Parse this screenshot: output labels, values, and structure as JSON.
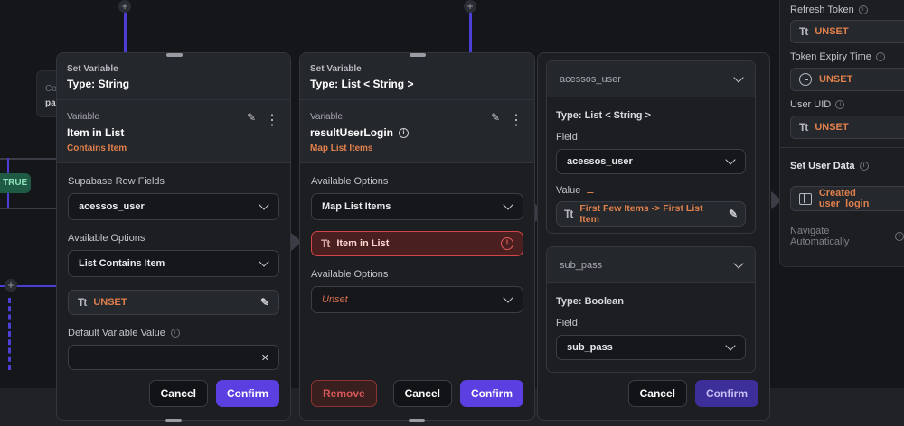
{
  "canvas": {
    "true_pill": "TRUE",
    "ghost_card_line1": "Co",
    "ghost_card_line2": "pa"
  },
  "panel1": {
    "header_small": "Set Variable",
    "header_type": "Type: String",
    "variable_label": "Variable",
    "variable_name": "Item in List",
    "variable_subtitle": "Contains Item",
    "supabase_label": "Supabase Row Fields",
    "supabase_value": "acessos_user",
    "options_label": "Available Options",
    "options_value": "List Contains Item",
    "unset_value": "UNSET",
    "default_label": "Default Variable Value",
    "default_value": "",
    "cancel": "Cancel",
    "confirm": "Confirm"
  },
  "panel2": {
    "header_small": "Set Variable",
    "header_type": "Type: List < String >",
    "variable_label": "Variable",
    "variable_name": "resultUserLogin",
    "variable_subtitle": "Map List Items",
    "options_label": "Available Options",
    "options_value": "Map List Items",
    "error_item": "Item in List",
    "options2_label": "Available Options",
    "options2_value": "Unset",
    "remove": "Remove",
    "cancel": "Cancel",
    "confirm": "Confirm"
  },
  "panel3": {
    "card1_title": "acessos_user",
    "card1_type": "Type: List < String >",
    "card1_field_label": "Field",
    "card1_field_value": "acessos_user",
    "card1_value_label": "Value",
    "card1_value": "First Few Items -> First List Item",
    "card2_title": "sub_pass",
    "card2_type": "Type: Boolean",
    "card2_field_label": "Field",
    "card2_field_value": "sub_pass",
    "cancel": "Cancel",
    "confirm": "Confirm"
  },
  "right_panel": {
    "refresh_label": "Refresh Token",
    "refresh_value": "UNSET",
    "expiry_label": "Token Expiry Time",
    "expiry_value": "UNSET",
    "uid_label": "User UID",
    "uid_value": "UNSET",
    "set_user_data": "Set User Data",
    "user_data_value": "Created user_login",
    "navigate": "Navigate Automatically"
  },
  "icons": {
    "text_type": "Tt",
    "plus": "+",
    "info": "i",
    "warn": "!",
    "close": "✕",
    "pencil": "✎",
    "more": "⋮"
  },
  "colors": {
    "accent": "#5b3fe0",
    "unset_orange": "#e0804c",
    "error_red": "#d04545",
    "true_green": "#1f5a44"
  }
}
